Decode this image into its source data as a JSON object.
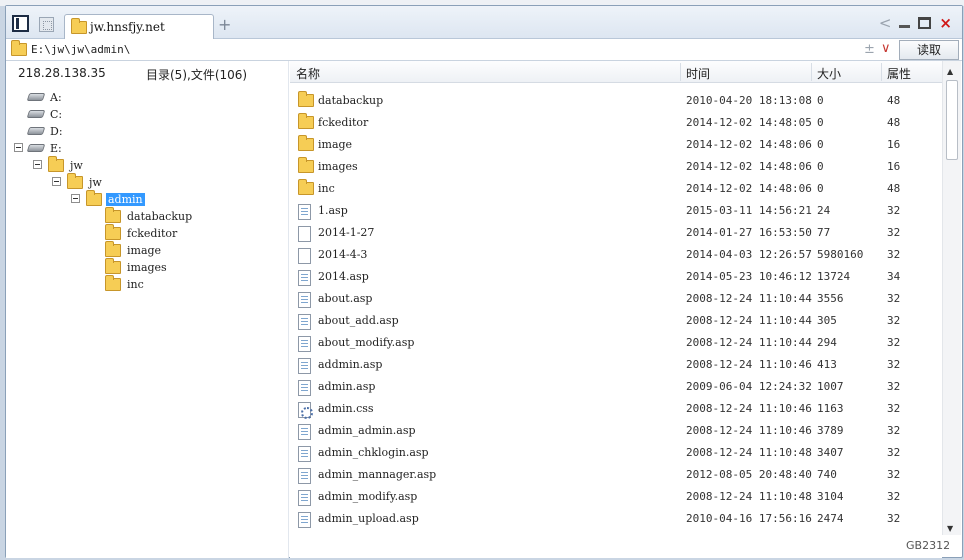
{
  "window": {
    "tab_title": "jw.hnsfjy.net",
    "new_tab": "+",
    "back": "<",
    "close": "×"
  },
  "address": {
    "path": "E:\\jw\\jw\\admin\\",
    "plusminus": "±",
    "dropdown": "∨",
    "read_button": "读取"
  },
  "left": {
    "ip": "218.28.138.35",
    "counts": "目录(5),文件(106)",
    "tree": [
      {
        "label": "A:",
        "type": "drive"
      },
      {
        "label": "C:",
        "type": "drive"
      },
      {
        "label": "D:",
        "type": "drive"
      },
      {
        "label": "E:",
        "type": "drive"
      },
      {
        "label": "jw",
        "type": "folder"
      },
      {
        "label": "jw",
        "type": "folder"
      },
      {
        "label": "admin",
        "type": "folder",
        "selected": true
      },
      {
        "label": "databackup",
        "type": "folder"
      },
      {
        "label": "fckeditor",
        "type": "folder"
      },
      {
        "label": "image",
        "type": "folder"
      },
      {
        "label": "images",
        "type": "folder"
      },
      {
        "label": "inc",
        "type": "folder"
      }
    ]
  },
  "list": {
    "headers": {
      "name": "名称",
      "time": "时间",
      "size": "大小",
      "attr": "属性"
    },
    "rows": [
      {
        "name": "databackup",
        "time": "2010-04-20 18:13:08",
        "size": "0",
        "attr": "48",
        "icon": "folder-icon"
      },
      {
        "name": "fckeditor",
        "time": "2014-12-02 14:48:05",
        "size": "0",
        "attr": "48",
        "icon": "folder-icon"
      },
      {
        "name": "image",
        "time": "2014-12-02 14:48:06",
        "size": "0",
        "attr": "16",
        "icon": "folder-icon"
      },
      {
        "name": "images",
        "time": "2014-12-02 14:48:06",
        "size": "0",
        "attr": "16",
        "icon": "folder-icon"
      },
      {
        "name": "inc",
        "time": "2014-12-02 14:48:06",
        "size": "0",
        "attr": "48",
        "icon": "folder-icon"
      },
      {
        "name": "1.asp",
        "time": "2015-03-11 14:56:21",
        "size": "24",
        "attr": "32",
        "icon": "asp-file-icon"
      },
      {
        "name": "2014-1-27",
        "time": "2014-01-27 16:53:50",
        "size": "77",
        "attr": "32",
        "icon": "blank-file-icon"
      },
      {
        "name": "2014-4-3",
        "time": "2014-04-03 12:26:57",
        "size": "5980160",
        "attr": "32",
        "icon": "blank-file-icon"
      },
      {
        "name": "2014.asp",
        "time": "2014-05-23 10:46:12",
        "size": "13724",
        "attr": "34",
        "icon": "asp-file-icon"
      },
      {
        "name": "about.asp",
        "time": "2008-12-24 11:10:44",
        "size": "3556",
        "attr": "32",
        "icon": "asp-file-icon"
      },
      {
        "name": "about_add.asp",
        "time": "2008-12-24 11:10:44",
        "size": "305",
        "attr": "32",
        "icon": "asp-file-icon"
      },
      {
        "name": "about_modify.asp",
        "time": "2008-12-24 11:10:44",
        "size": "294",
        "attr": "32",
        "icon": "asp-file-icon"
      },
      {
        "name": "addmin.asp",
        "time": "2008-12-24 11:10:46",
        "size": "413",
        "attr": "32",
        "icon": "asp-file-icon"
      },
      {
        "name": "admin.asp",
        "time": "2009-06-04 12:24:32",
        "size": "1007",
        "attr": "32",
        "icon": "asp-file-icon"
      },
      {
        "name": "admin.css",
        "time": "2008-12-24 11:10:46",
        "size": "1163",
        "attr": "32",
        "icon": "css-file-icon"
      },
      {
        "name": "admin_admin.asp",
        "time": "2008-12-24 11:10:46",
        "size": "3789",
        "attr": "32",
        "icon": "asp-file-icon"
      },
      {
        "name": "admin_chklogin.asp",
        "time": "2008-12-24 11:10:48",
        "size": "3407",
        "attr": "32",
        "icon": "asp-file-icon"
      },
      {
        "name": "admin_mannager.asp",
        "time": "2012-08-05 20:48:40",
        "size": "740",
        "attr": "32",
        "icon": "asp-file-icon"
      },
      {
        "name": "admin_modify.asp",
        "time": "2008-12-24 11:10:48",
        "size": "3104",
        "attr": "32",
        "icon": "asp-file-icon"
      },
      {
        "name": "admin_upload.asp",
        "time": "2010-04-16 17:56:16",
        "size": "2474",
        "attr": "32",
        "icon": "asp-file-icon"
      }
    ]
  },
  "status": {
    "encoding": "GB2312"
  },
  "colors": {
    "selection": "#3399ff",
    "folder": "#f6cd55",
    "close": "#d01818"
  }
}
